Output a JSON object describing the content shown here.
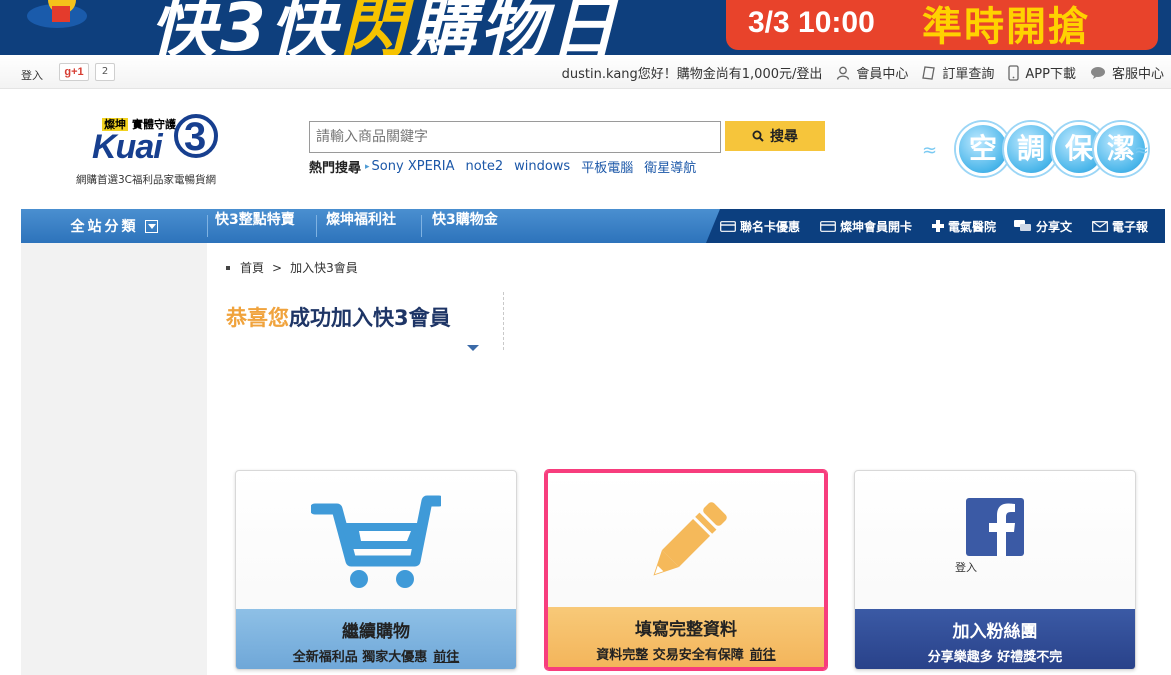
{
  "banner": {
    "slogan_prefix": "快3快",
    "slogan_bolt": "閃",
    "slogan_suffix": "購物日",
    "time": "3/3 10:00",
    "cta": "準時開搶"
  },
  "topbar": {
    "login": "登入",
    "gplus_label": "g+1",
    "gplus_count": "2",
    "greeting": "dustin.kang您好！購物金尚有1,000元/登出",
    "member_center": "會員中心",
    "order_query": "訂單查詢",
    "app_download": "APP下載",
    "customer_service": "客服中心"
  },
  "logo": {
    "badge_brand": "燦坤",
    "badge_text": "實體守護",
    "word": "Kuai",
    "tagline": "網購首選3C福利品家電暢貨網"
  },
  "search": {
    "placeholder": "請輸入商品關鍵字",
    "button": "搜尋",
    "hot_label": "熱門搜尋",
    "hot_keywords": [
      "Sony XPERIA",
      "note2",
      "windows",
      "平板電腦",
      "衛星導航"
    ]
  },
  "promo": {
    "chars": [
      "空",
      "調",
      "保",
      "潔"
    ]
  },
  "nav": {
    "all_categories": "全站分類",
    "links": [
      "快3整點特賣",
      "燦坤福利社",
      "快3購物金"
    ],
    "services": [
      "聯名卡優惠",
      "燦坤會員開卡",
      "電氣醫院",
      "分享文",
      "電子報"
    ]
  },
  "breadcrumb": {
    "home": "首頁",
    "separator": ">",
    "current": "加入快3會員"
  },
  "page": {
    "title_highlight": "恭喜您",
    "title_rest": "成功加入快3會員"
  },
  "cards": [
    {
      "title": "繼續購物",
      "subtitle": "全新福利品 獨家大優惠",
      "link": "前往"
    },
    {
      "title": "填寫完整資料",
      "subtitle": "資料完整 交易安全有保障",
      "link": "前往"
    },
    {
      "title": "加入粉絲團",
      "subtitle": "分享樂趣多 好禮獎不完",
      "fb_login": "登入"
    }
  ],
  "colors": {
    "banner_bg": "#0e3f7d",
    "nav_blue": "#2d73bb",
    "nav_dark": "#0c3f7f",
    "accent_orange": "#f0a33d",
    "search_button": "#f6c53b",
    "highlight_border": "#f73d7d",
    "facebook_blue": "#3b5aa5"
  }
}
